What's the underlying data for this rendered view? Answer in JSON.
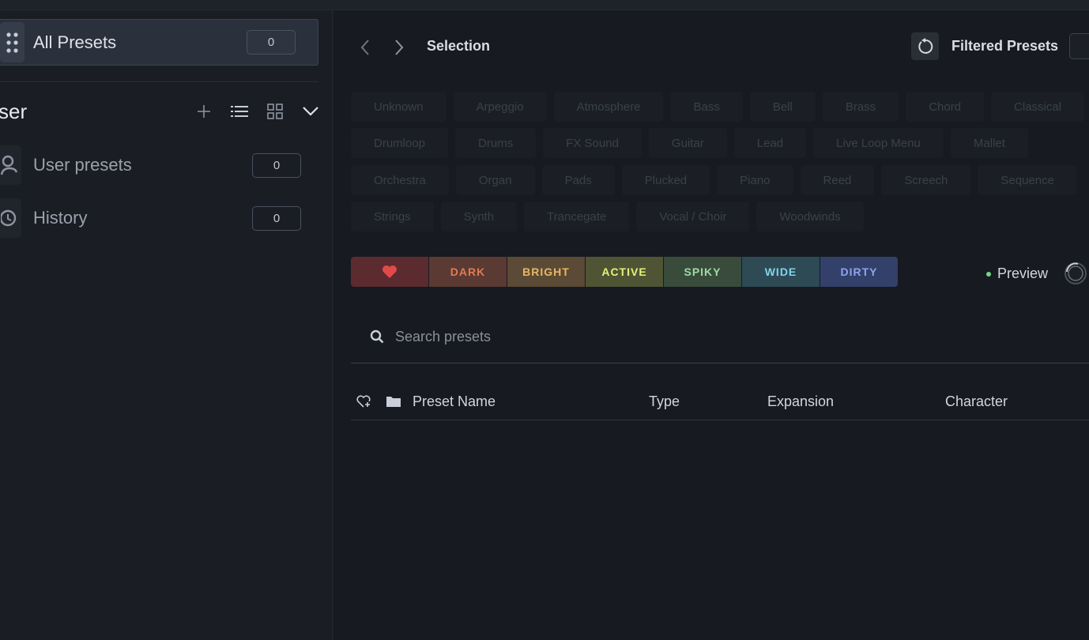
{
  "sidebar": {
    "all_presets": {
      "label": "All Presets",
      "count": "0"
    },
    "user_section": {
      "title": "ser"
    },
    "items": [
      {
        "label": "User presets",
        "count": "0",
        "icon": "user-icon"
      },
      {
        "label": "History",
        "count": "0",
        "icon": "history-icon"
      }
    ]
  },
  "header": {
    "title": "Selection",
    "filtered_label": "Filtered Presets"
  },
  "type_chips": [
    [
      "Unknown",
      "Arpeggio",
      "Atmosphere",
      "Bass",
      "Bell",
      "Brass",
      "Chord",
      "Classical"
    ],
    [
      "Drumloop",
      "Drums",
      "FX Sound",
      "Guitar",
      "Lead",
      "Live Loop Menu",
      "Mallet"
    ],
    [
      "Orchestra",
      "Organ",
      "Pads",
      "Plucked",
      "Piano",
      "Reed",
      "Screech",
      "Sequence"
    ],
    [
      "Strings",
      "Synth",
      "Trancegate",
      "Vocal / Choir",
      "Woodwinds"
    ]
  ],
  "character_tags": [
    {
      "label": "",
      "icon": "heart-icon",
      "bg": "#5b2b30",
      "fg": "#e04a4a"
    },
    {
      "label": "DARK",
      "bg": "#5a3a33",
      "fg": "#e27a52"
    },
    {
      "label": "BRIGHT",
      "bg": "#5b4a35",
      "fg": "#e8b765"
    },
    {
      "label": "ACTIVE",
      "bg": "#4f5534",
      "fg": "#e7f07a"
    },
    {
      "label": "SPIKY",
      "bg": "#394c3c",
      "fg": "#9fd9a4"
    },
    {
      "label": "WIDE",
      "bg": "#2e4a55",
      "fg": "#7fd4ea"
    },
    {
      "label": "DIRTY",
      "bg": "#33406a",
      "fg": "#8fa4ef"
    }
  ],
  "preview": {
    "label": "Preview"
  },
  "search": {
    "placeholder": "Search presets",
    "value": ""
  },
  "table": {
    "columns": [
      "Preset Name",
      "Type",
      "Expansion",
      "Character"
    ]
  }
}
